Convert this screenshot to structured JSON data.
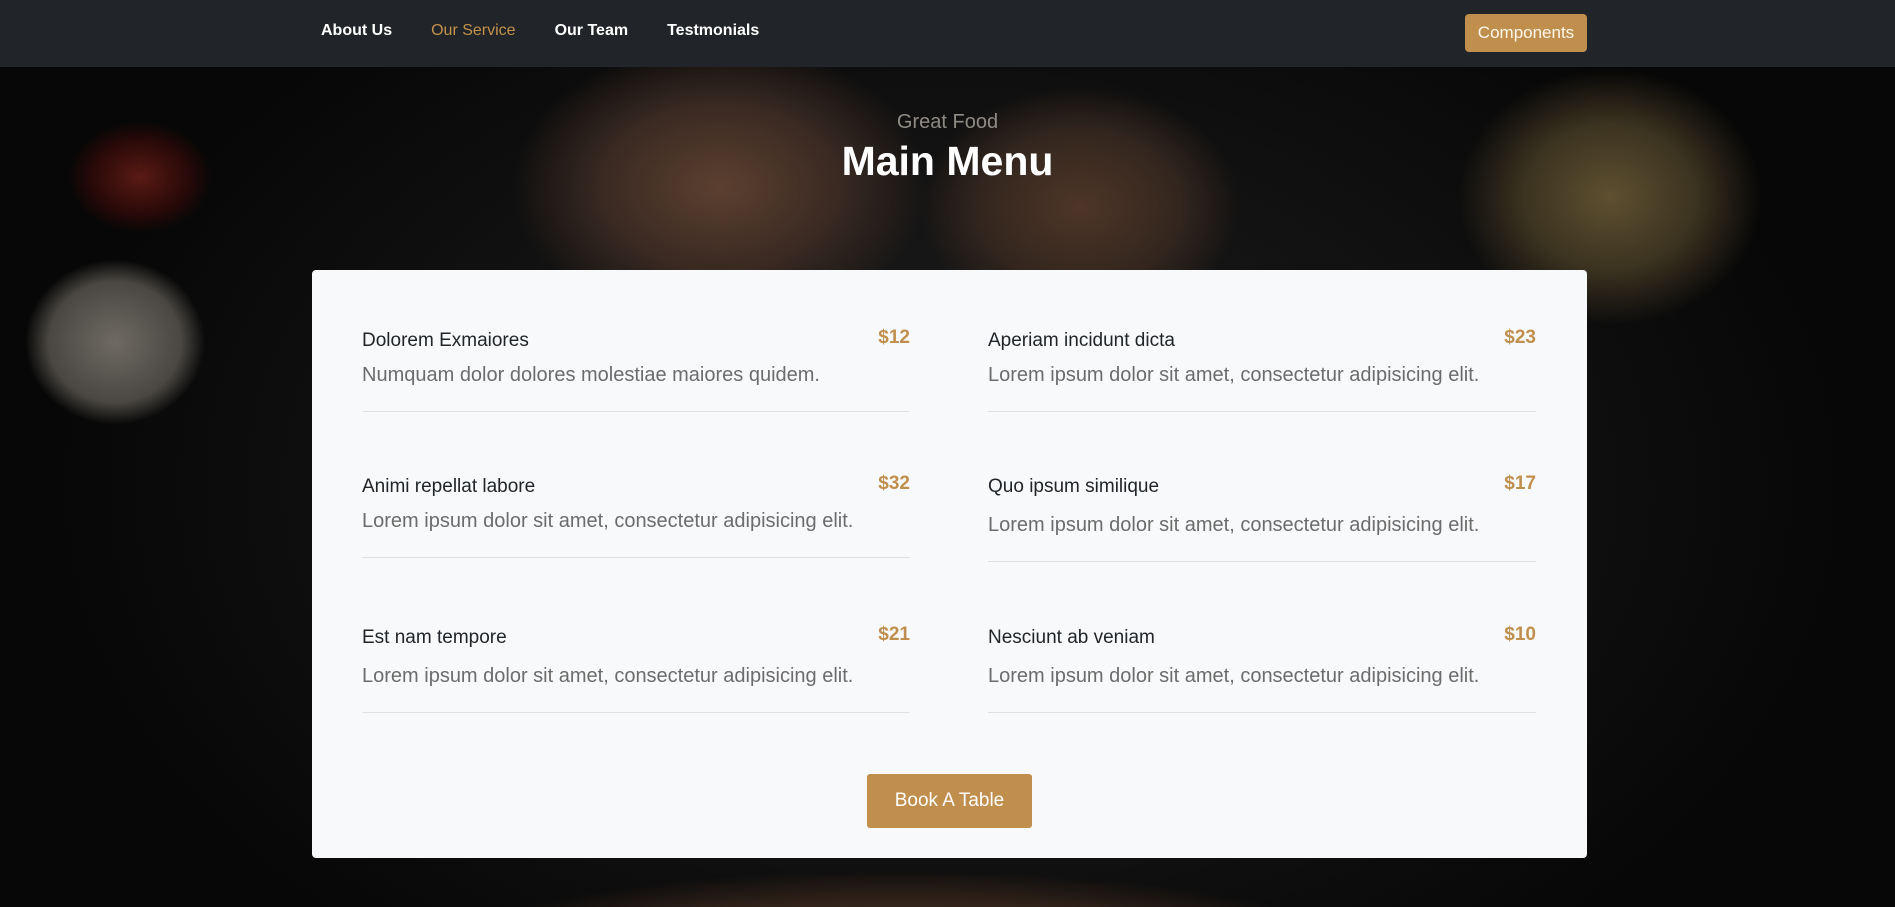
{
  "nav": {
    "links": [
      {
        "label": "About Us"
      },
      {
        "label": "Our Service"
      },
      {
        "label": "Our Team"
      },
      {
        "label": "Testmonials"
      }
    ],
    "components_label": "Components"
  },
  "hero": {
    "subtitle": "Great Food",
    "title": "Main Menu"
  },
  "menu": {
    "items": [
      {
        "name": "Dolorem Exmaiores",
        "price": "$12",
        "description": "Numquam dolor dolores molestiae maiores quidem."
      },
      {
        "name": "Aperiam incidunt dicta",
        "price": "$23",
        "description": "Lorem ipsum dolor sit amet, consectetur adipisicing elit."
      },
      {
        "name": "Animi repellat labore",
        "price": "$32",
        "description": "Lorem ipsum dolor sit amet, consectetur adipisicing elit."
      },
      {
        "name": "Quo ipsum similique",
        "price": "$17",
        "description": "Lorem ipsum dolor sit amet, consectetur adipisicing elit."
      },
      {
        "name": "Est nam tempore",
        "price": "$21",
        "description": "Lorem ipsum dolor sit amet, consectetur adipisicing elit."
      },
      {
        "name": "Nesciunt ab veniam",
        "price": "$10",
        "description": "Lorem ipsum dolor sit amet, consectetur adipisicing elit."
      }
    ],
    "book_label": "Book A Table"
  },
  "colors": {
    "accent": "#c18f4d",
    "navbar": "#212429",
    "card": "#f8f9fa"
  }
}
